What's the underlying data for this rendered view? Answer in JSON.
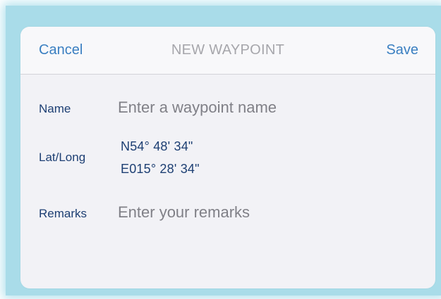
{
  "dialog": {
    "title": "NEW WAYPOINT",
    "cancel_label": "Cancel",
    "save_label": "Save"
  },
  "form": {
    "name": {
      "label": "Name",
      "value": "",
      "placeholder": "Enter a waypoint name"
    },
    "latlong": {
      "label": "Lat/Long",
      "latitude": "N54° 48' 34\"",
      "longitude": "E015° 28' 34\""
    },
    "remarks": {
      "label": "Remarks",
      "value": "",
      "placeholder": "Enter your remarks"
    }
  },
  "colors": {
    "accent": "#3a7fc1",
    "label": "#1d3f73",
    "placeholder": "#808087",
    "title": "#a6a6ab",
    "dialog_background": "#f2f2f6",
    "backdrop": "#a9dce9"
  }
}
